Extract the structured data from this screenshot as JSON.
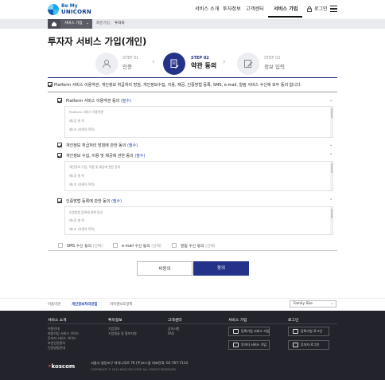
{
  "header": {
    "logo_line1": "Be My",
    "logo_line2": "UNICORN",
    "nav": [
      "서비스 소개",
      "투자정보",
      "고객센터",
      "서비스 가입"
    ],
    "login": "로그인"
  },
  "breadcrumb": {
    "selected": "서비스 가입",
    "items": [
      "회원가입",
      "투자자"
    ]
  },
  "page_title": "투자자 서비스 가입(개인)",
  "steps": [
    {
      "no": "STEP 01",
      "label": "인증",
      "icon": "user-icon",
      "active": false
    },
    {
      "no": "STEP 02",
      "label": "약관 동의",
      "icon": "document-edit-icon",
      "active": true
    },
    {
      "no": "STEP 03",
      "label": "정보 입력",
      "icon": "pencil-icon",
      "active": false
    }
  ],
  "agree_all": "Platform 서비스 이용약관, 개인정보 취급처리 방침, 개인정보수집, 이용, 제공, 인증방법 등록, SMS, e-mail, 알림 서비스 수신에 모두 동의 합니다.",
  "terms": [
    {
      "title": "Platform 서비스 이용약관 동의",
      "required": "(필수)",
      "lines": [
        "Platform 서비스 이용약관",
        "제1장 총 칙",
        "제1조 (약관의 목적)"
      ]
    },
    {
      "title": "개인정보 취급처리 방침에 관한 동의",
      "required": "(필수)",
      "lines": []
    },
    {
      "title": "개인정보 수집, 이용 및 제공에 관한 동의",
      "required": "(필수)",
      "lines": [
        "개인정보 수집, 이용 및 제공에 관한 동의",
        "제1장 총 칙",
        "제1조 (약관의 목적)"
      ]
    },
    {
      "title": "인증방법 등록에 관한 동의",
      "required": "(필수)",
      "lines": [
        "인증방법 등록에 관한 동의",
        "제1장 총 칙",
        "제1조 (약관의 목적)"
      ]
    }
  ],
  "optional": [
    {
      "label": "SMS 수신 동의",
      "tag": "(선택)"
    },
    {
      "label": "e-mail 수신 동의",
      "tag": "(선택)"
    },
    {
      "label": "알림 수신 동의",
      "tag": "(선택)"
    }
  ],
  "buttons": {
    "disagree": "비동의",
    "agree": "동의"
  },
  "footer_links": [
    "이용약관",
    "개인정보처리방침",
    "저작권보호정책"
  ],
  "family_site": "Family Site",
  "footer": {
    "columns": [
      {
        "title": "서비스 소개",
        "items": [
          "이용안내",
          "회원가입 서비스 가이드",
          "투자자 서비스 가이드",
          "보안인증절차",
          "인증방법안내"
        ]
      },
      {
        "title": "투자정보",
        "items": [
          "기업정보",
          "기업발굴 및 홍보지원"
        ]
      },
      {
        "title": "고객센터",
        "items": [
          "공지사항",
          "FAQ"
        ]
      }
    ],
    "service_join": {
      "title": "서비스 가입",
      "buttons": [
        "등록기업 서비스 가입",
        "투자자 서비스 가입"
      ]
    },
    "login": {
      "title": "로그인",
      "buttons": [
        "등록기업 로그인",
        "투자자 로그인"
      ]
    },
    "brand": "koscom",
    "address": "서울시 영등포구 여의나루로 76 (주)코스콤    대표전화: 02-767-7114",
    "copyright": "COPYRIGHT © 2019 KOSCOM CORP. ALL RIGHTS RESERVED."
  },
  "colors": {
    "brand_navy": "#24328a",
    "required_blue": "#1e3fb6",
    "footer_bg": "#23242b"
  }
}
